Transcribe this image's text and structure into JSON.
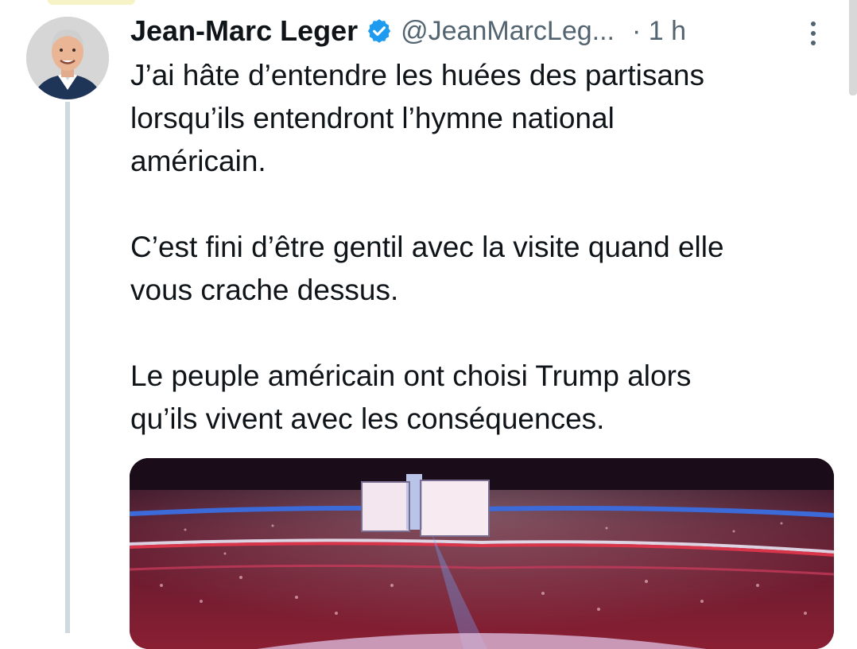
{
  "tweet": {
    "author_name": "Jean-Marc Leger",
    "handle": "@JeanMarcLeg...",
    "time": "· 1 h",
    "paragraphs": [
      "J’ai hâte d’entendre les huées des partisans\nlorsqu’ils entendront l’hymne national\naméricain.",
      "C’est fini d’être gentil avec la visite quand elle\nvous crache dessus.",
      "Le peuple américain ont choisi Trump alors\nqu’ils vivent avec les conséquences."
    ]
  },
  "icons": {
    "verified": "verified-badge-icon",
    "more": "more-vertical-icon",
    "avatar": "avatar"
  },
  "colors": {
    "verified_blue": "#1d9bf0",
    "text_primary": "#0f1419",
    "text_secondary": "#536471",
    "thread_line": "#cfd9de"
  }
}
